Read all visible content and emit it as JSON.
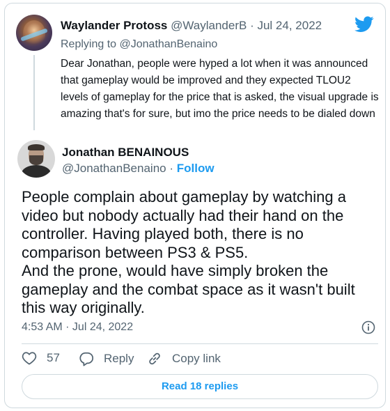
{
  "parent_tweet": {
    "author_name": "Waylander Protoss",
    "author_handle": "@WaylanderB",
    "separator": "·",
    "date": "Jul 24, 2022",
    "replying_prefix": "Replying to",
    "replying_to": "@JonathanBenaino",
    "text": "Dear Jonathan, people were hyped a lot when it was announced that gameplay would be improved and they expected TLOU2 levels of gameplay for the price that is asked, the visual upgrade is amazing that's for sure, but imo the price needs to be dialed down"
  },
  "main_tweet": {
    "author_name": "Jonathan BENAINOUS",
    "author_handle": "@JonathanBenaino",
    "separator": "·",
    "follow_label": "Follow",
    "text_lines": [
      "People complain about gameplay by watching a",
      "video but nobody actually had their hand on the",
      "controller. Having played both, there is no",
      "comparison between PS3 & PS5.",
      "And the prone, would have simply broken the",
      "gameplay and the combat space as it wasn't built",
      "this way originally."
    ],
    "timestamp": "4:53 AM · Jul 24, 2022"
  },
  "actions": {
    "like_count": "57",
    "reply_label": "Reply",
    "copy_label": "Copy link"
  },
  "read_replies_label": "Read 18 replies",
  "icons": {
    "brand": "twitter-bird-icon",
    "like": "heart-icon",
    "reply": "speech-bubble-icon",
    "copy": "link-icon",
    "info": "info-icon"
  },
  "colors": {
    "accent": "#1d9bf0",
    "text": "#0f1419",
    "secondary": "#536471",
    "border": "#cfd9de"
  }
}
